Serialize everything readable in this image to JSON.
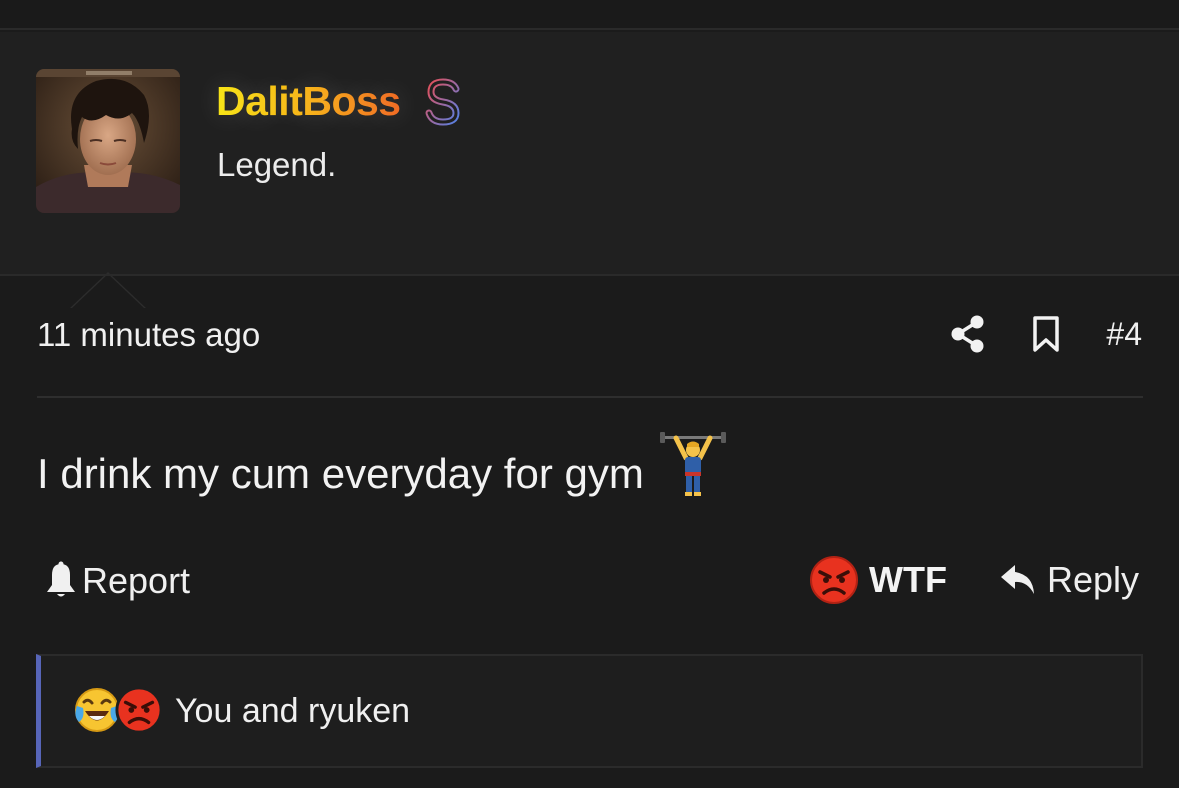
{
  "post": {
    "username": "DalitBoss",
    "user_title": "Legend.",
    "timestamp": "11 minutes ago",
    "post_number": "#4",
    "body_text": "I drink my cum everyday for gym",
    "body_icon": "person-lifting-weights-icon"
  },
  "actions": {
    "report_label": "Report",
    "reaction_label": "WTF",
    "reply_label": "Reply"
  },
  "reactions_summary": {
    "text": "You and ryuken",
    "icons": [
      "laughing-crying-face-icon",
      "angry-face-icon"
    ]
  },
  "colors": {
    "background": "#1b1b1b",
    "user_block_bg": "#202020",
    "username_gradient": [
      "#f7e40f",
      "#f0661e"
    ],
    "reactions_accent": "#5765b8",
    "angry_red": "#e8321f"
  }
}
